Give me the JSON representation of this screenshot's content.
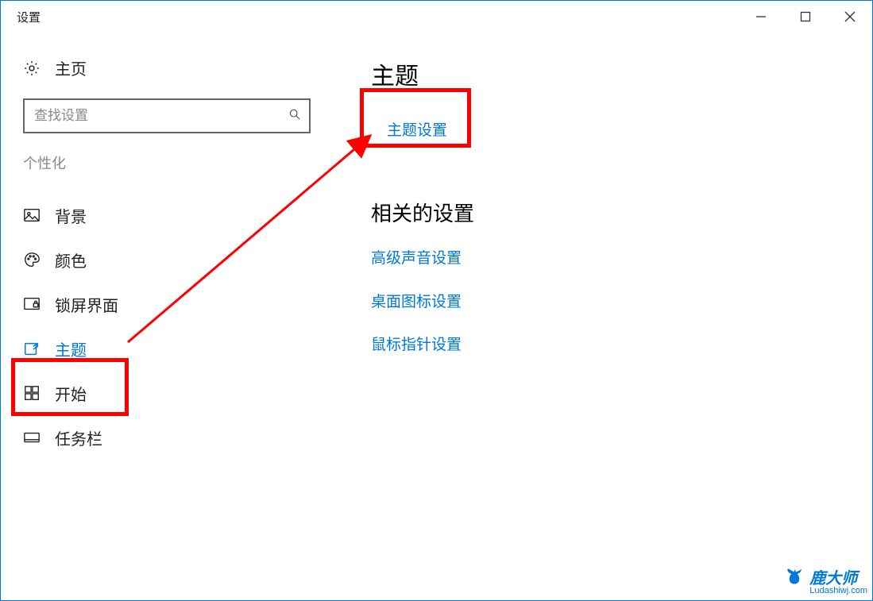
{
  "window": {
    "title": "设置"
  },
  "sidebar": {
    "home": "主页",
    "search_placeholder": "查找设置",
    "category": "个性化",
    "items": [
      {
        "label": "背景"
      },
      {
        "label": "颜色"
      },
      {
        "label": "锁屏界面"
      },
      {
        "label": "主题"
      },
      {
        "label": "开始"
      },
      {
        "label": "任务栏"
      }
    ],
    "active_index": 3
  },
  "main": {
    "heading": "主题",
    "theme_settings_link": "主题设置",
    "related_heading": "相关的设置",
    "related_links": [
      "高级声音设置",
      "桌面图标设置",
      "鼠标指针设置"
    ]
  },
  "watermark": {
    "cn": "鹿大师",
    "en": "Ludashiwj.com"
  },
  "annotations": {
    "highlight_nav_theme": true,
    "highlight_theme_settings": true,
    "arrow_from_nav_to_settings": true
  }
}
